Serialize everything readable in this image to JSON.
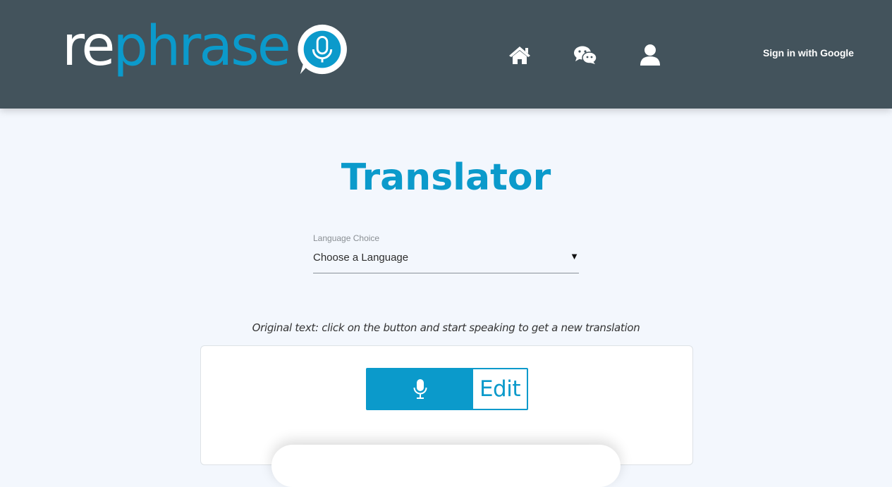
{
  "header": {
    "logo": {
      "part1": "re",
      "part2": "phrase"
    },
    "nav": [
      {
        "icon": "home-icon"
      },
      {
        "icon": "wechat-icon"
      },
      {
        "icon": "user-icon"
      }
    ],
    "signin_label": "Sign in with Google"
  },
  "main": {
    "title": "Translator",
    "language": {
      "label": "Language Choice",
      "selected": "Choose a Language",
      "arrow": "▼"
    },
    "hint": "Original text: click on the button and start speaking to get a new translation",
    "edit_label": "Edit"
  },
  "colors": {
    "header_bg": "#43535c",
    "accent": "#0b9acb",
    "page_bg": "#f3f7fd"
  }
}
